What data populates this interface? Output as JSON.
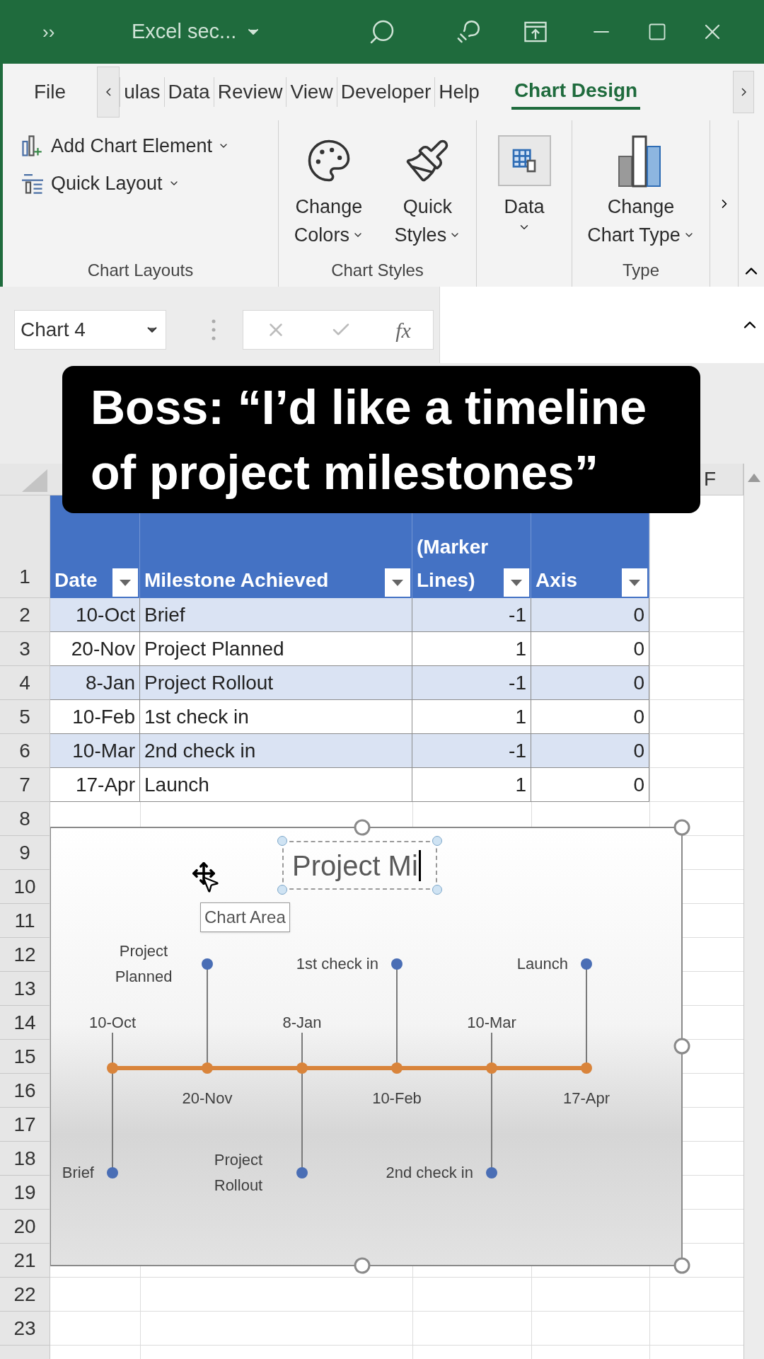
{
  "title_bar": {
    "overflow": "››",
    "document": "Excel sec..."
  },
  "ribbon": {
    "tabs": [
      {
        "label": "File",
        "selected": false
      },
      {
        "label": "ulas",
        "selected": false
      },
      {
        "label": "Data",
        "selected": false
      },
      {
        "label": "Review",
        "selected": false
      },
      {
        "label": "View",
        "selected": false
      },
      {
        "label": "Developer",
        "selected": false
      },
      {
        "label": "Help",
        "selected": false
      },
      {
        "label": "Chart Design",
        "selected": true
      }
    ],
    "groups": [
      {
        "kind": "layouts",
        "label": "Chart Layouts",
        "commands": [
          {
            "lines": [
              "Add Chart Element"
            ]
          },
          {
            "lines": [
              "Quick Layout"
            ]
          }
        ]
      },
      {
        "kind": "styles",
        "label": "Chart Styles",
        "commands": [
          {
            "lines": [
              "Change",
              "Colors"
            ]
          },
          {
            "lines": [
              "Quick",
              "Styles"
            ]
          }
        ]
      },
      {
        "kind": "data",
        "commands": [
          {
            "lines": [
              "Data"
            ]
          }
        ]
      },
      {
        "kind": "type",
        "label": "Type",
        "commands": [
          {
            "lines": [
              "Change",
              "Chart Type"
            ]
          }
        ]
      }
    ]
  },
  "formula_bar": {
    "name_box": "Chart 4",
    "function_label": "fx"
  },
  "caption": "Boss: “I’d like a timeline of project milestones”",
  "sheet": {
    "column_letters": [
      "F"
    ],
    "row_numbers": [
      "1",
      "2",
      "3",
      "4",
      "5",
      "6",
      "7",
      "8",
      "9",
      "10",
      "11",
      "12",
      "13",
      "14",
      "15",
      "16",
      "17",
      "18",
      "19",
      "20",
      "21",
      "22",
      "23"
    ],
    "table": {
      "columns": [
        "Date",
        "Milestone Achieved",
        "(Marker Lines)",
        "Axis"
      ],
      "rows": [
        [
          "10-Oct",
          "Brief",
          "-1",
          "0"
        ],
        [
          "20-Nov",
          "Project Planned",
          "1",
          "0"
        ],
        [
          "8-Jan",
          "Project Rollout",
          "-1",
          "0"
        ],
        [
          "10-Feb",
          "1st check in",
          "1",
          "0"
        ],
        [
          "10-Mar",
          "2nd check in",
          "-1",
          "0"
        ],
        [
          "17-Apr",
          "Launch",
          "1",
          "0"
        ]
      ]
    }
  },
  "chart": {
    "title": "Project Mi",
    "tooltip": "Chart Area",
    "points": [
      {
        "date": "10-Oct",
        "label": "Brief",
        "kind": "below"
      },
      {
        "date": "20-Nov",
        "label": "Project Planned",
        "kind": "above"
      },
      {
        "date": "8-Jan",
        "label": "Project Rollout",
        "kind": "below"
      },
      {
        "date": "10-Feb",
        "label": "1st check in",
        "kind": "above"
      },
      {
        "date": "10-Mar",
        "label": "2nd check in",
        "kind": "below"
      },
      {
        "date": "17-Apr",
        "label": "Launch",
        "kind": "above"
      }
    ]
  }
}
